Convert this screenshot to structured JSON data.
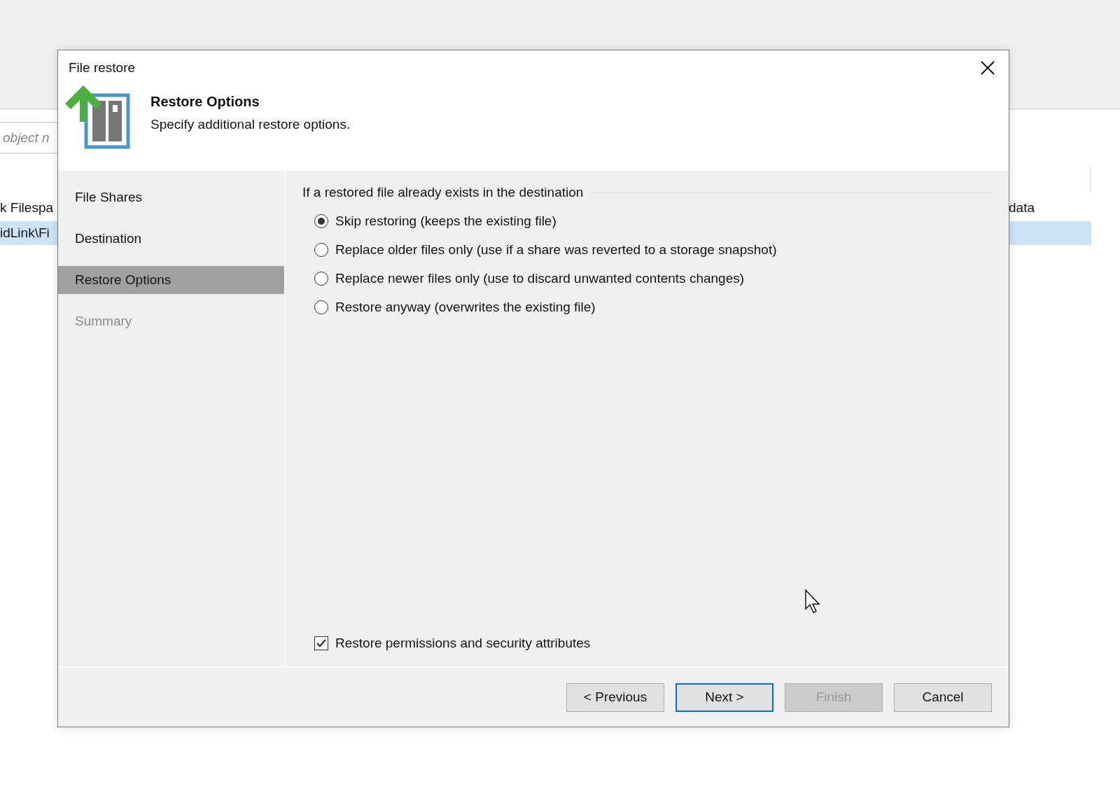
{
  "background_app": {
    "search": {
      "placeholder": "object n"
    },
    "rows": [
      {
        "cells": [
          "k Filespa",
          "data"
        ],
        "selected": false
      },
      {
        "cells": [
          "idLink\\Fi",
          ""
        ],
        "selected": true
      }
    ]
  },
  "dialog": {
    "title": "File restore",
    "header": {
      "title": "Restore Options",
      "subtitle": "Specify additional restore options."
    },
    "steps": [
      {
        "label": "File Shares",
        "selected": false,
        "disabled": false
      },
      {
        "label": "Destination",
        "selected": false,
        "disabled": false
      },
      {
        "label": "Restore Options",
        "selected": true,
        "disabled": false
      },
      {
        "label": "Summary",
        "selected": false,
        "disabled": true
      }
    ],
    "group_label": "If a restored file already exists in the destination",
    "options": [
      {
        "label": "Skip restoring (keeps the existing file)",
        "selected": true
      },
      {
        "label": "Replace older files only (use if a share was reverted to a storage snapshot)",
        "selected": false
      },
      {
        "label": "Replace newer files only (use to discard unwanted contents changes)",
        "selected": false
      },
      {
        "label": "Restore anyway (overwrites the existing file)",
        "selected": false
      }
    ],
    "permissions": {
      "label": "Restore permissions and security attributes",
      "checked": true
    },
    "buttons": [
      {
        "label": "< Previous",
        "focused": false,
        "disabled": false
      },
      {
        "label": "Next >",
        "focused": true,
        "disabled": false
      },
      {
        "label": "Finish",
        "focused": false,
        "disabled": true
      },
      {
        "label": "Cancel",
        "focused": false,
        "disabled": false
      }
    ]
  }
}
